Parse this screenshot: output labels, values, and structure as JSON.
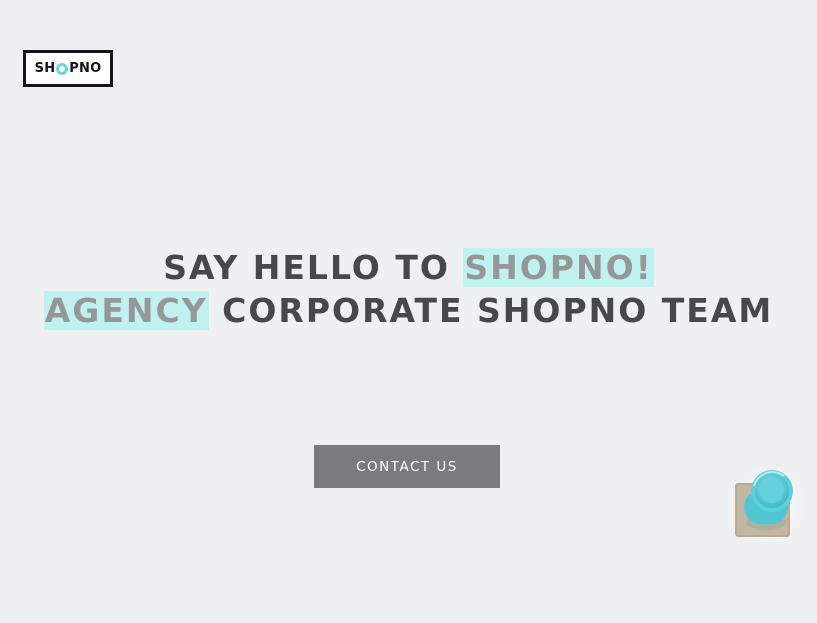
{
  "logo": {
    "text_before": "SH",
    "text_after": "PNO"
  },
  "hero": {
    "line1_plain": "SAY HELLO TO ",
    "line1_highlight": "SHOPNO!",
    "line2_highlight": "AGENCY",
    "line2_plain": " CORPORATE SHOPNO TEAM"
  },
  "cta": {
    "label": "CONTACT US"
  },
  "colors": {
    "background": "#eff0f2",
    "highlight": "#bff2ef",
    "heading_text": "#48484a",
    "highlight_text": "#969799",
    "button": "#7a7b7d",
    "logo_accent": "#6fd6d5"
  },
  "decor": {
    "image": "cup-on-coaster-image"
  }
}
